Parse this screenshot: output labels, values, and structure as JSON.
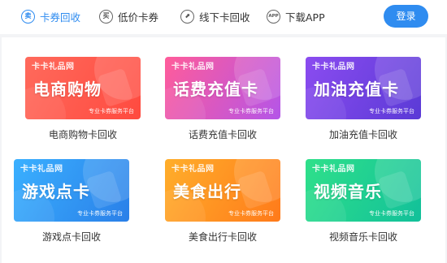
{
  "nav": {
    "items": [
      {
        "icon": "卖",
        "label": "卡券回收",
        "active": true
      },
      {
        "icon": "买",
        "label": "低价卡券",
        "active": false
      },
      {
        "icon": "⬈",
        "label": "线下卡回收",
        "active": false
      },
      {
        "icon": "APP",
        "label": "下载APP",
        "active": false
      }
    ],
    "login_label": "登录"
  },
  "cards": [
    {
      "brand": "卡卡礼品网",
      "title": "电商购物",
      "subtitle": "专业卡券服务平台",
      "caption": "电商购物卡回收"
    },
    {
      "brand": "卡卡礼品网",
      "title": "话费充值卡",
      "subtitle": "专业卡券服务平台",
      "caption": "话费充值卡回收"
    },
    {
      "brand": "卡卡礼品网",
      "title": "加油充值卡",
      "subtitle": "专业卡券服务平台",
      "caption": "加油充值卡回收"
    },
    {
      "brand": "卡卡礼品网",
      "title": "游戏点卡",
      "subtitle": "专业卡券服务平台",
      "caption": "游戏点卡回收"
    },
    {
      "brand": "卡卡礼品网",
      "title": "美食出行",
      "subtitle": "专业卡券服务平台",
      "caption": "美食出行卡回收"
    },
    {
      "brand": "卡卡礼品网",
      "title": "视频音乐",
      "subtitle": "专业卡券服务平台",
      "caption": "视频音乐卡回收"
    }
  ],
  "colors": {
    "accent": "#2f8cf0",
    "ecommerce": "#ff5a4c",
    "phone": "#e058b8",
    "fuel": "#7444e6",
    "game": "#3097f5",
    "food": "#ff9522",
    "video": "#22d090"
  }
}
